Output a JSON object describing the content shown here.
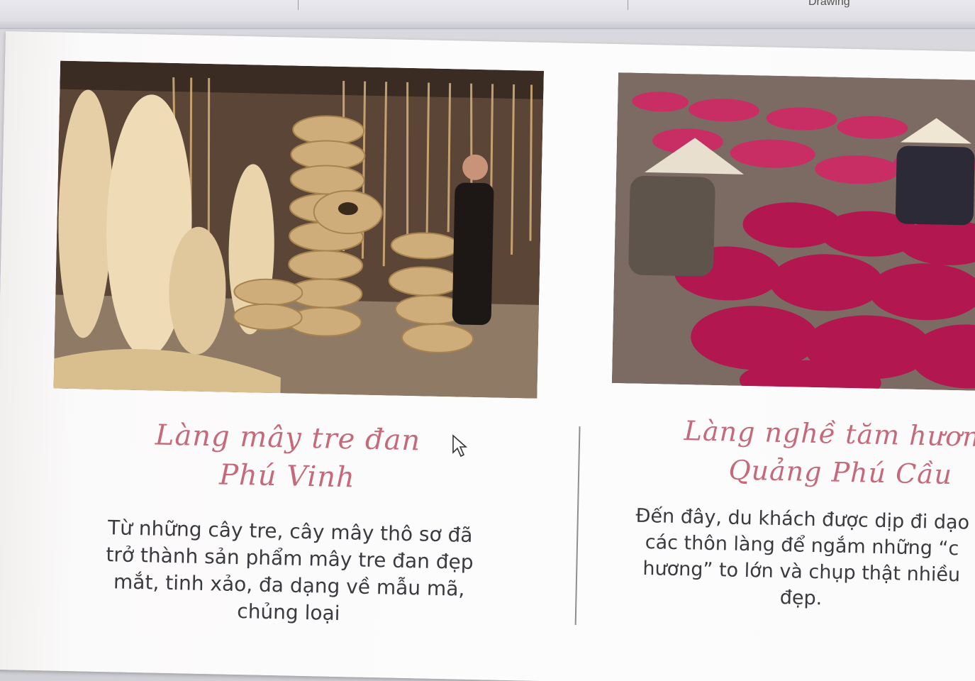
{
  "ribbon": {
    "tab_label": "Drawing"
  },
  "slide": {
    "left_card": {
      "title_line1": "Làng mây tre đan",
      "title_line2": "Phú Vinh",
      "description_lines": [
        "Từ những  cây tre, cây mây thô sơ đã",
        "trở thành sản phẩm mây tre đan đẹp",
        "mắt, tinh xảo, đa dạng về mẫu mã,",
        "chủng loại"
      ]
    },
    "right_card": {
      "title_line1": "Làng nghề tăm hương",
      "title_line2": "Quảng Phú Cầu",
      "description_lines": [
        "Đến đây, du khách được dịp đi dạo",
        "các thôn làng để ngắm những “c",
        "hương” to lớn và chụp thật nhiều",
        "đẹp."
      ]
    }
  },
  "colors": {
    "title": "#c56a7a",
    "body_text": "#3a3a40",
    "incense_pink": "#c2185b",
    "bamboo": "#d9b98a"
  }
}
